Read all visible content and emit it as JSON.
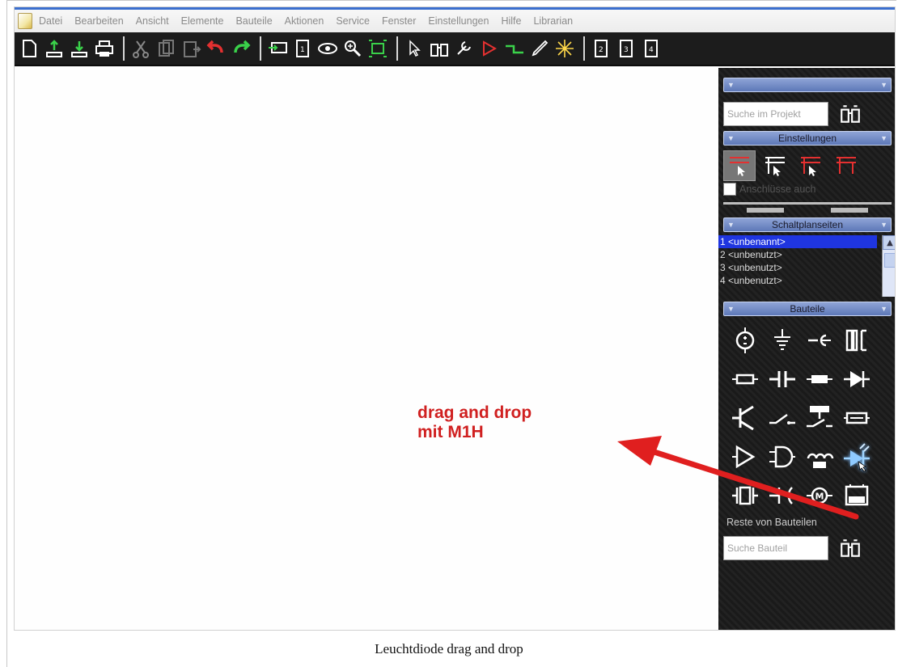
{
  "menu": {
    "items": [
      "Datei",
      "Bearbeiten",
      "Ansicht",
      "Elemente",
      "Bauteile",
      "Aktionen",
      "Service",
      "Fenster",
      "Einstellungen",
      "Hilfe",
      "Librarian"
    ]
  },
  "panel": {
    "project_search_placeholder": "Suche im Projekt",
    "settings_header": "Einstellungen",
    "connections_checkbox_label": "Anschlüsse auch",
    "pages_header": "Schaltplanseiten",
    "pages": [
      "1 <unbenannt>",
      "2 <unbenutzt>",
      "3 <unbenutzt>",
      "4 <unbenutzt>"
    ],
    "components_header": "Bauteile",
    "rest_label": "Reste von Bauteilen",
    "component_search_placeholder": "Suche Bauteil"
  },
  "annotation": {
    "line1": "drag and drop",
    "line2": "mit M1H",
    "color": "#d02020"
  },
  "caption": "Leuchtdiode drag and drop",
  "colors": {
    "toolbar_bg": "#1c1c1c",
    "panel_header": "#5d78b8",
    "selected_page": "#1f35e0"
  }
}
